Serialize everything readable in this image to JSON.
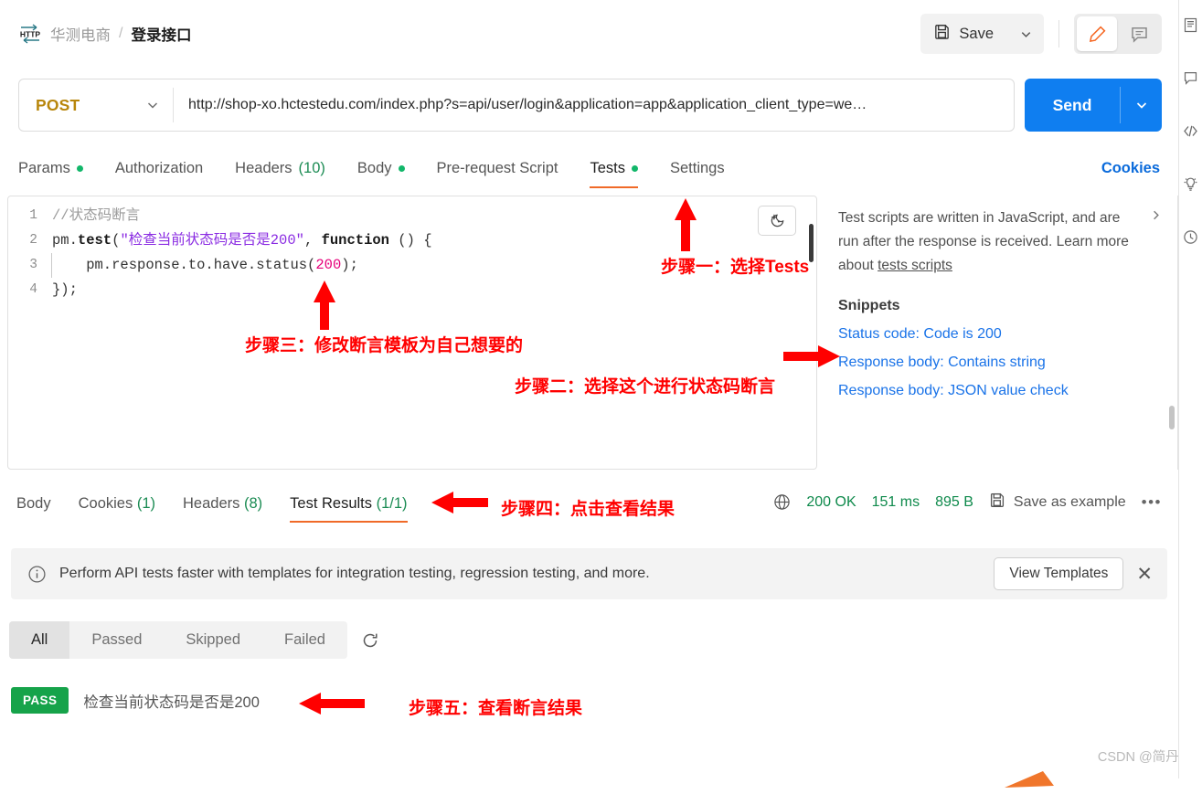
{
  "header": {
    "protocol_badge": "HTTP",
    "collection": "华测电商",
    "separator": "/",
    "request_name": "登录接口",
    "save_label": "Save"
  },
  "url_bar": {
    "method": "POST",
    "url": "http://shop-xo.hctestedu.com/index.php?s=api/user/login&application=app&application_client_type=we…",
    "send_label": "Send"
  },
  "request_tabs": [
    {
      "label": "Params",
      "dot": true,
      "active": false
    },
    {
      "label": "Authorization",
      "dot": false,
      "active": false
    },
    {
      "label": "Headers",
      "count": "(10)",
      "dot": false,
      "active": false
    },
    {
      "label": "Body",
      "dot": true,
      "active": false
    },
    {
      "label": "Pre-request Script",
      "dot": false,
      "active": false
    },
    {
      "label": "Tests",
      "dot": true,
      "active": true
    },
    {
      "label": "Settings",
      "dot": false,
      "active": false
    }
  ],
  "cookies_link": "Cookies",
  "editor": {
    "lines": [
      {
        "num": "1",
        "tokens": [
          {
            "t": "//状态码断言",
            "c": "cmt"
          }
        ]
      },
      {
        "num": "2",
        "tokens": [
          {
            "t": "pm.",
            "c": "plain"
          },
          {
            "t": "test",
            "c": "fn"
          },
          {
            "t": "(",
            "c": "plain"
          },
          {
            "t": "\"检查当前状态码是否是200\"",
            "c": "str"
          },
          {
            "t": ", ",
            "c": "plain"
          },
          {
            "t": "function",
            "c": "fn"
          },
          {
            "t": " () {",
            "c": "plain"
          }
        ]
      },
      {
        "num": "3",
        "indent": true,
        "tokens": [
          {
            "t": "    pm.response.to.have.status(",
            "c": "plain"
          },
          {
            "t": "200",
            "c": "num"
          },
          {
            "t": ");",
            "c": "plain"
          }
        ]
      },
      {
        "num": "4",
        "tokens": [
          {
            "t": "});",
            "c": "plain"
          }
        ]
      }
    ]
  },
  "side_panel": {
    "description": "Test scripts are written in JavaScript, and are run after the response is received. Learn more about ",
    "description_link": "tests scripts",
    "snippets_title": "Snippets",
    "snippets": [
      "Status code: Code is 200",
      "Response body: Contains string",
      "Response body: JSON value check"
    ]
  },
  "response_tabs": [
    {
      "label": "Body",
      "active": false
    },
    {
      "label": "Cookies",
      "count": "(1)",
      "active": false
    },
    {
      "label": "Headers",
      "count": "(8)",
      "active": false
    },
    {
      "label": "Test Results",
      "count": "(1/1)",
      "active": true
    }
  ],
  "response_meta": {
    "status": "200 OK",
    "time": "151 ms",
    "size": "895 B",
    "save_example": "Save as example"
  },
  "banner": {
    "text": "Perform API tests faster with templates for integration testing, regression testing, and more.",
    "cta": "View Templates"
  },
  "filters": [
    {
      "label": "All",
      "active": true
    },
    {
      "label": "Passed",
      "active": false
    },
    {
      "label": "Skipped",
      "active": false
    },
    {
      "label": "Failed",
      "active": false
    }
  ],
  "test_results": [
    {
      "status": "PASS",
      "name": "检查当前状态码是否是200"
    }
  ],
  "annotations": {
    "step1": "步骤一：选择Tests",
    "step2": "步骤二：选择这个进行状态码断言",
    "step3": "步骤三：修改断言模板为自己想要的",
    "step4": "步骤四：点击查看结果",
    "step5": "步骤五：查看断言结果"
  },
  "watermark": "CSDN @简丹**",
  "colors": {
    "accent_orange": "#f06a28",
    "send_blue": "#0f7ef0",
    "link_blue": "#1a73e8",
    "pass_green": "#16a34a",
    "method_amber": "#b8860b",
    "annotation_red": "#ff0000"
  }
}
